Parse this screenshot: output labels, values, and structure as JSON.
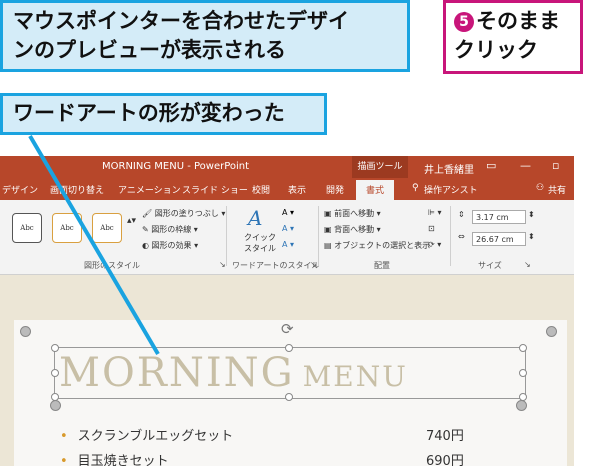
{
  "callouts": {
    "main_line1": "マウスポインターを合わせたデザイ",
    "main_line2": "ンのプレビューが表示される",
    "step_number": "5",
    "step_line1": "そのまま",
    "step_line2": "クリック",
    "changed": "ワードアートの形が変わった"
  },
  "app": {
    "title": "MORNING MENU - PowerPoint",
    "context_tab": "描画ツール",
    "user": "井上香緒里"
  },
  "tabs": [
    "デザイン",
    "画面切り替え",
    "アニメーション",
    "スライド ショー",
    "校閲",
    "表示",
    "開発",
    "書式",
    "操作アシスト",
    "共有"
  ],
  "active_tab": "書式",
  "ribbon": {
    "shape_style_sample": "Abc",
    "shape_fill": "図形の塗りつぶし",
    "shape_outline": "図形の枠線",
    "shape_effect": "図形の効果",
    "group_shape_styles": "図形のスタイル",
    "quick_styles": "クイック\nスタイル",
    "group_wordart_styles": "ワードアートのスタイル",
    "bring_forward": "前面へ移動",
    "send_backward": "背面へ移動",
    "selection_pane": "オブジェクトの選択と表示",
    "group_arrange": "配置",
    "height_value": "3.17 cm",
    "width_value": "26.67 cm",
    "group_size": "サイズ"
  },
  "slide": {
    "wordart_main": "MORNING",
    "wordart_sub": "MENU",
    "items": [
      {
        "name": "スクランブルエッグセット",
        "price": "740円"
      },
      {
        "name": "目玉焼きセット",
        "price": "690円"
      }
    ]
  },
  "colors": {
    "callout_border": "#1aa3e0",
    "step_accent": "#c8157a",
    "ppt_red": "#b7472a"
  }
}
